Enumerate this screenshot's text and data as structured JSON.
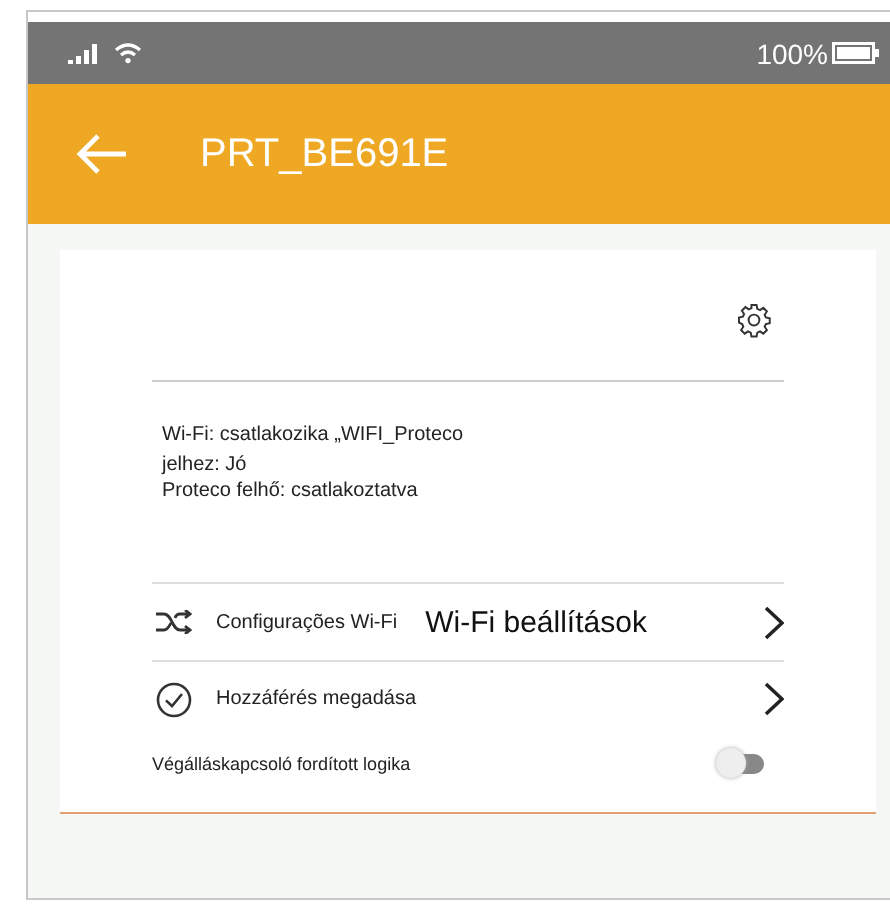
{
  "status_bar": {
    "battery": "100%"
  },
  "header": {
    "title": "PRT_BE691E"
  },
  "info": [
    "Wi-Fi: csatlakozika „WIFI_Proteco",
    "jelhez: Jó",
    "Proteco felhő: csatlakoztatva"
  ],
  "rows": [
    {
      "kind": "link",
      "label": "Configurações Wi-Fi",
      "overlay_label": "Wi-Fi beállítások"
    },
    {
      "kind": "link",
      "label": "Hozzáférés megadása"
    },
    {
      "kind": "toggle",
      "label": "Végálláskapcsoló fordított logika",
      "on": false
    }
  ]
}
